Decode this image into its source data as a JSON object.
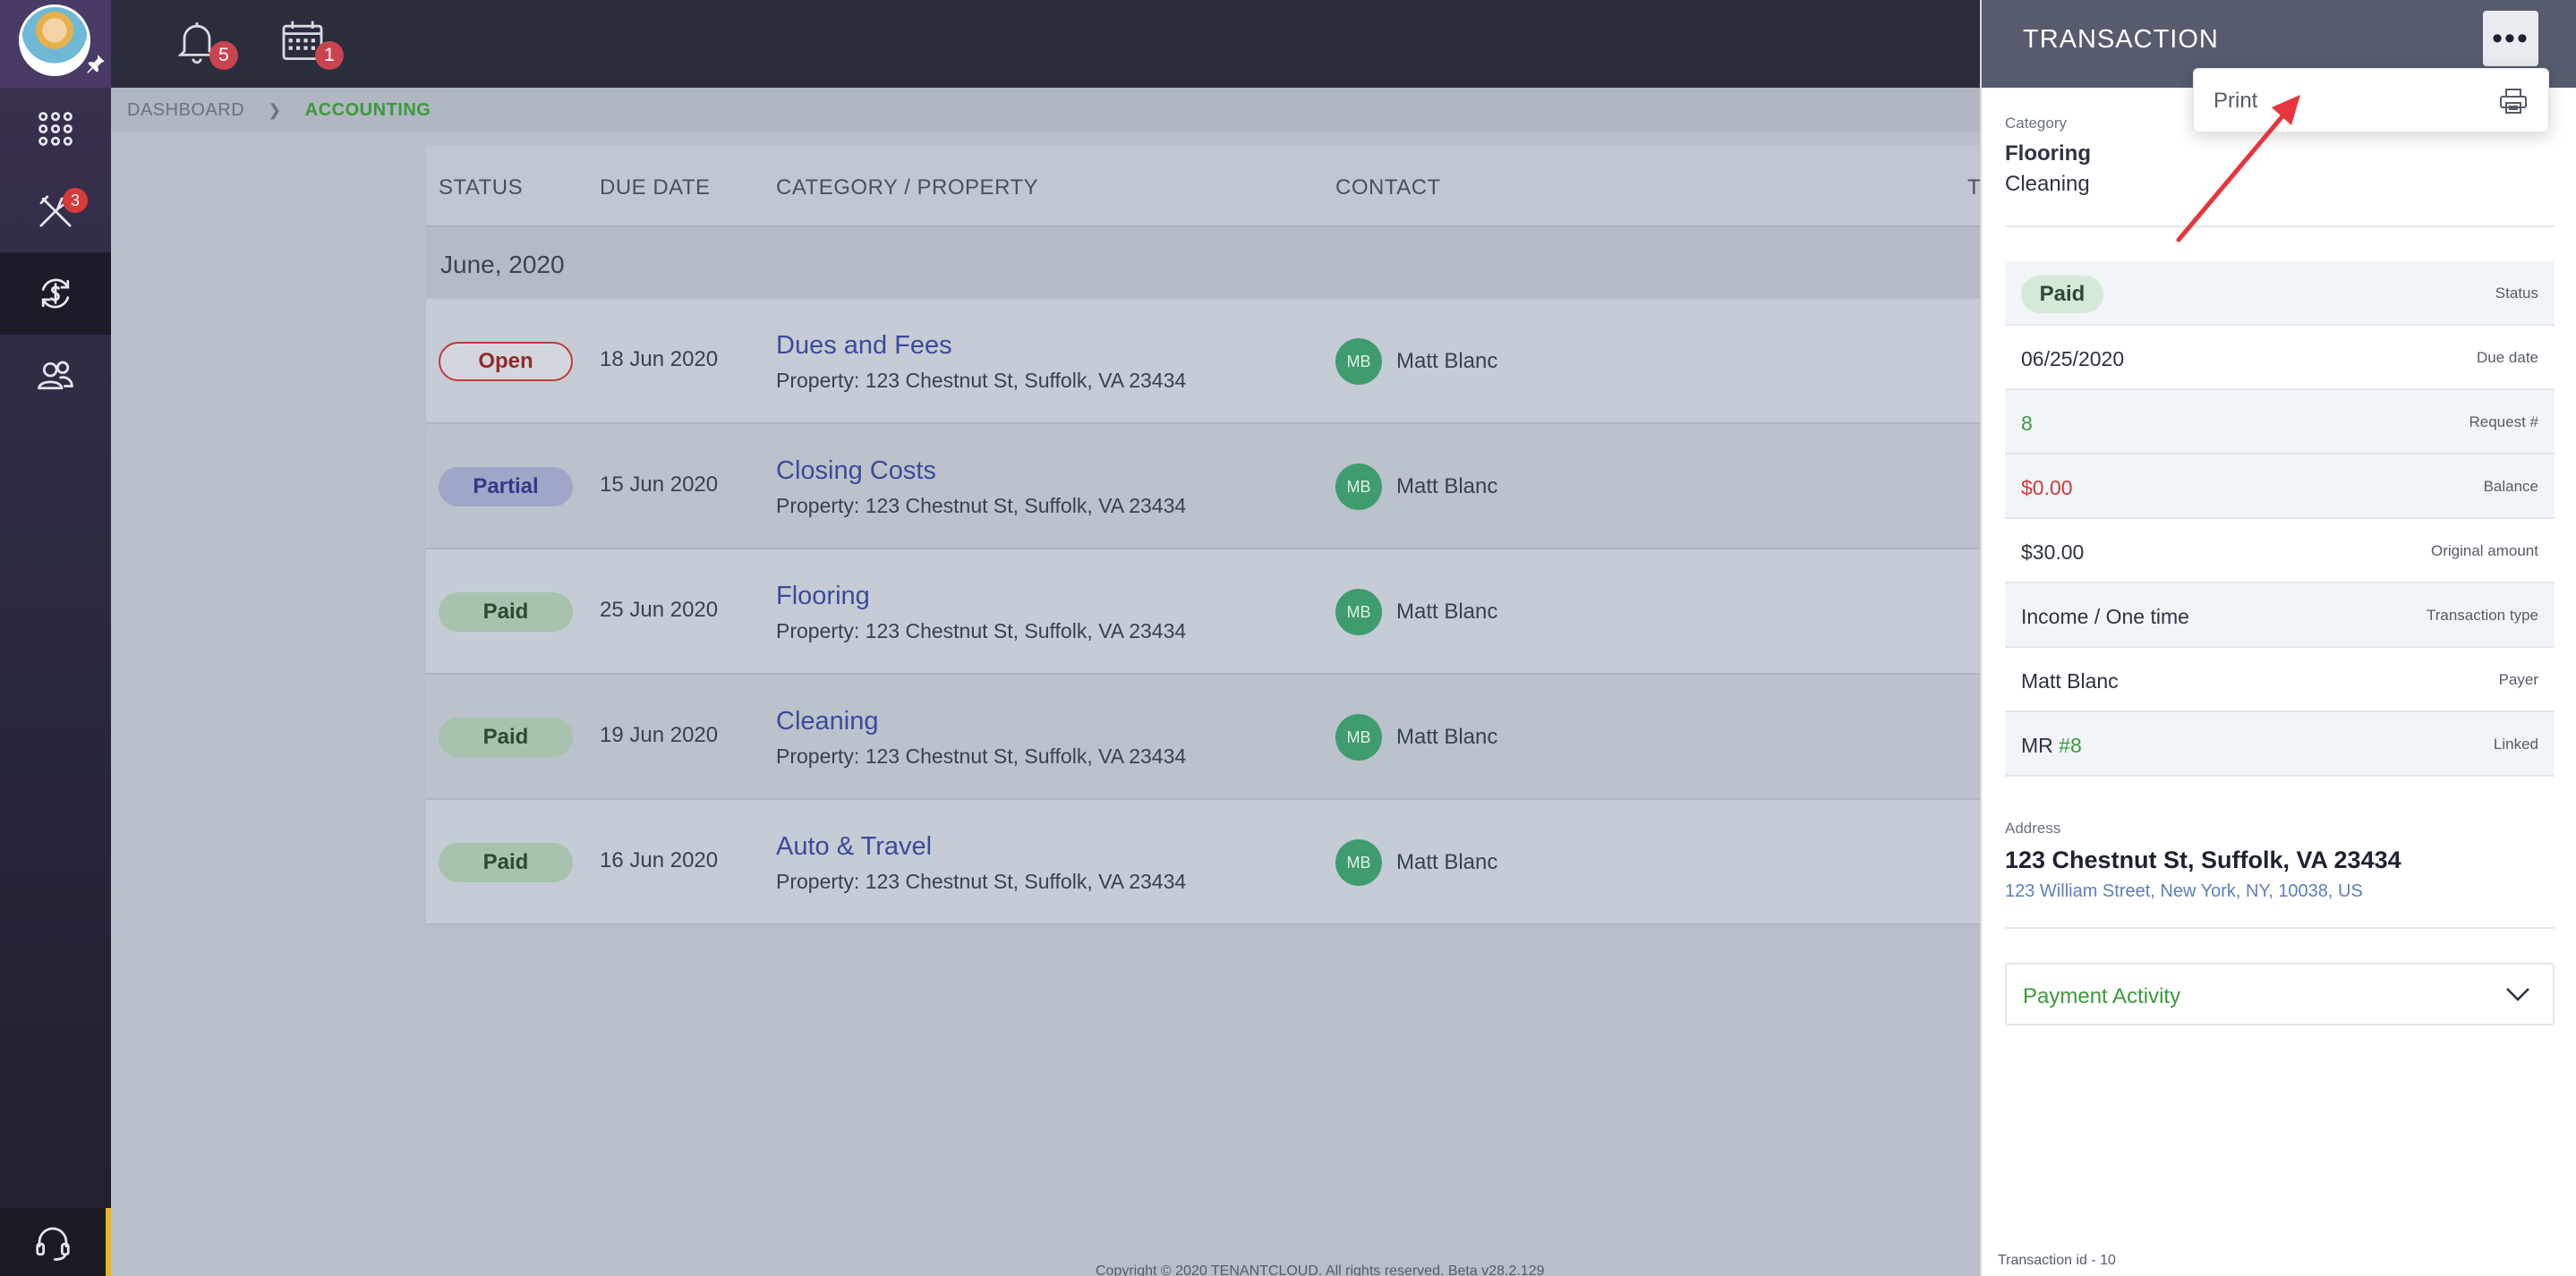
{
  "sidebar": {
    "items": [
      {
        "icon": "apps-grid-icon"
      },
      {
        "icon": "tools-icon",
        "badge": "3"
      },
      {
        "icon": "accounting-icon",
        "active": true
      },
      {
        "icon": "contacts-icon"
      }
    ],
    "support_icon": "headset-icon"
  },
  "topbar": {
    "notifications_badge": "5",
    "calendar_badge": "1"
  },
  "breadcrumb": {
    "items": [
      "DASHBOARD",
      "ACCOUNTING"
    ]
  },
  "table": {
    "columns": [
      "STATUS",
      "DUE DATE",
      "CATEGORY / PROPERTY",
      "CONTACT",
      "T"
    ],
    "group": "June, 2020",
    "rows": [
      {
        "status": "Open",
        "due": "18 Jun 2020",
        "category": "Dues and Fees",
        "property": "Property: 123 Chestnut St, Suffolk, VA 23434",
        "initials": "MB",
        "contact": "Matt Blanc"
      },
      {
        "status": "Partial",
        "due": "15 Jun 2020",
        "category": "Closing Costs",
        "property": "Property: 123 Chestnut St, Suffolk, VA 23434",
        "initials": "MB",
        "contact": "Matt Blanc"
      },
      {
        "status": "Paid",
        "due": "25 Jun 2020",
        "category": "Flooring",
        "property": "Property: 123 Chestnut St, Suffolk, VA 23434",
        "initials": "MB",
        "contact": "Matt Blanc"
      },
      {
        "status": "Paid",
        "due": "19 Jun 2020",
        "category": "Cleaning",
        "property": "Property: 123 Chestnut St, Suffolk, VA 23434",
        "initials": "MB",
        "contact": "Matt Blanc"
      },
      {
        "status": "Paid",
        "due": "16 Jun 2020",
        "category": "Auto & Travel",
        "property": "Property: 123 Chestnut St, Suffolk, VA 23434",
        "initials": "MB",
        "contact": "Matt Blanc"
      }
    ]
  },
  "footer": {
    "copyright": "Copyright © 2020 TENANTCLOUD. All rights reserved. Beta v28.2.129"
  },
  "panel": {
    "title": "TRANSACTION",
    "more_label": "•••",
    "menu": {
      "print_label": "Print"
    },
    "category_label": "Category",
    "categories": [
      "Flooring",
      "Cleaning"
    ],
    "details": {
      "status_value": "Paid",
      "status_key": "Status",
      "due_value": "06/25/2020",
      "due_key": "Due date",
      "request_value": "8",
      "request_key": "Request #",
      "balance_value": "$0.00",
      "balance_key": "Balance",
      "original_value": "$30.00",
      "original_key": "Original amount",
      "type_value": "Income / One time",
      "type_key": "Transaction type",
      "payer_value": "Matt Blanc",
      "payer_key": "Payer",
      "linked_prefix": "MR",
      "linked_value": "#8",
      "linked_key": "Linked"
    },
    "address_label": "Address",
    "address_main": "123 Chestnut St, Suffolk, VA 23434",
    "address_sub": "123 William Street, New York, NY, 10038, US",
    "payment_activity_label": "Payment Activity",
    "transaction_id": "Transaction id - 10"
  },
  "colors": {
    "accent_green": "#3a9a3a",
    "link_blue": "#3b4b9a",
    "danger_red": "#d03a3a",
    "annotation_arrow": "#e8343a"
  }
}
